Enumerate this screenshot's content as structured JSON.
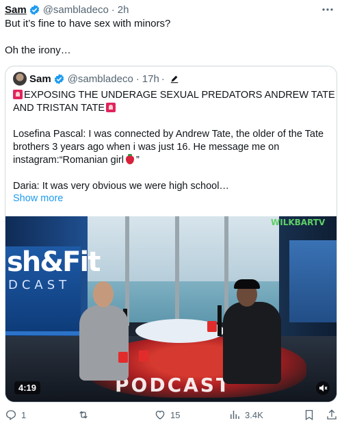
{
  "tweet": {
    "author_name": "Sam",
    "author_handle": "@sambladeco",
    "separator": "·",
    "time": "2h",
    "body_line1": "But it’s fine to have sex with minors?",
    "body_line2": "Oh the irony…"
  },
  "quote": {
    "author_name": "Sam",
    "author_handle": "@sambladeco",
    "separator": "·",
    "time": "17h",
    "separator2": "·",
    "headline_line1": "EXPOSING THE UNDERAGE SEXUAL PREDATORS ANDREW TATE",
    "headline_line2": "AND TRISTAN TATE",
    "para1_line1": "Losefina Pascal: I was connected by Andrew Tate, the older of the Tate",
    "para1_line2": "brothers 3 years ago when i was just 16. He message me on",
    "para1_line3a": "instagram:“Romanian girl",
    "para1_line3b": "”",
    "para2": "Daria: It was very obvious we were high school…",
    "show_more": "Show more"
  },
  "video": {
    "duration": "4:19",
    "brand_text": "sh&Fit",
    "brand_text2": "DCAST",
    "watermark": "WILKBARTV",
    "table_text": "PODCAST"
  },
  "actions": {
    "replies": "1",
    "retweets": "",
    "likes": "15",
    "views": "3.4K"
  },
  "colors": {
    "verified": "#1d9bf0",
    "link": "#1d9bf0",
    "muted": "#536471",
    "border": "#cfd9de"
  }
}
